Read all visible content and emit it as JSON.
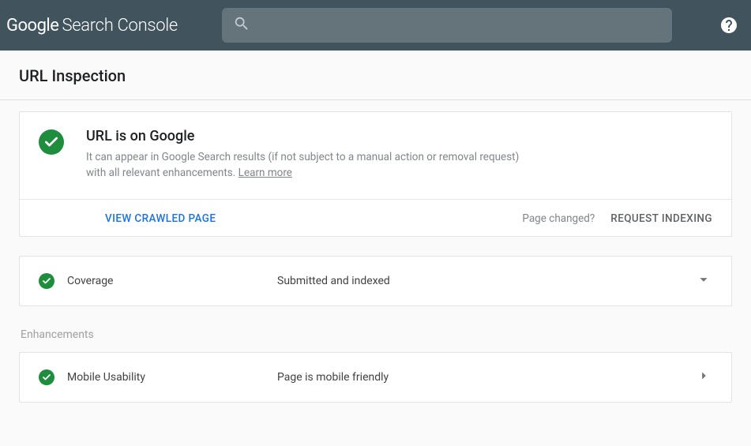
{
  "header": {
    "logo_google": "Google",
    "logo_product": "Search Console",
    "search_placeholder": ""
  },
  "page": {
    "title": "URL Inspection"
  },
  "status": {
    "title": "URL is on Google",
    "description_prefix": "It can appear in Google Search results (if not subject to a manual action or removal request) with all relevant enhancements. ",
    "learn_more": "Learn more"
  },
  "actions": {
    "view_crawled": "VIEW CRAWLED PAGE",
    "page_changed": "Page changed?",
    "request_indexing": "REQUEST INDEXING"
  },
  "coverage": {
    "label": "Coverage",
    "value": "Submitted and indexed"
  },
  "enhancements_header": "Enhancements",
  "mobile": {
    "label": "Mobile Usability",
    "value": "Page is mobile friendly"
  }
}
